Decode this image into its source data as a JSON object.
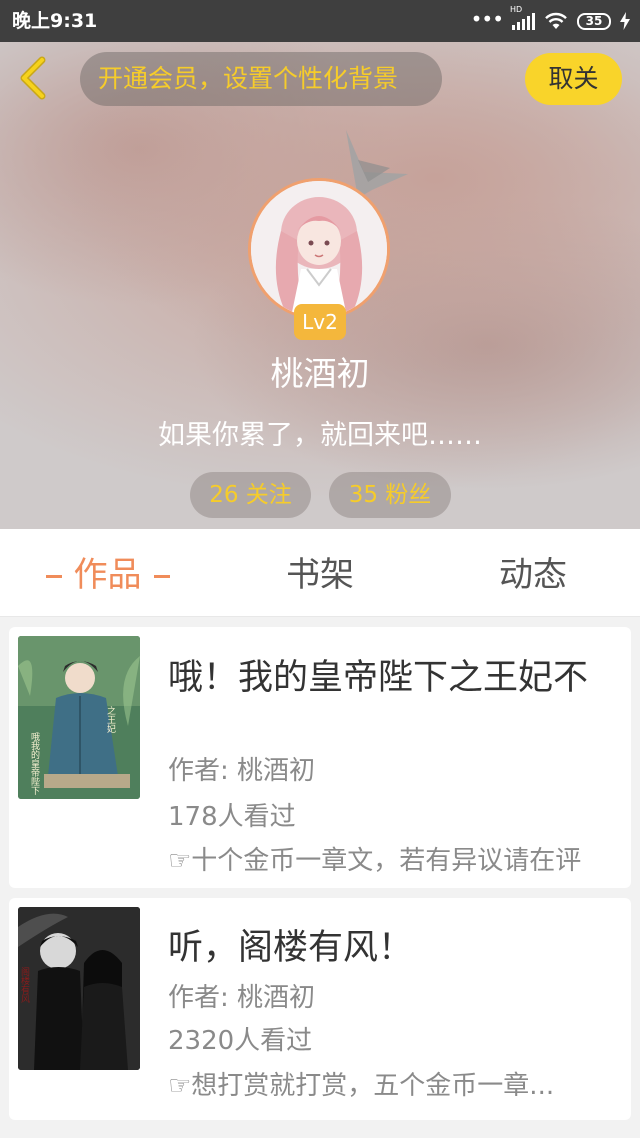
{
  "status_bar": {
    "time": "晚上9:31",
    "network_label": "HD",
    "battery": "35"
  },
  "header": {
    "vip_banner": "开通会员，设置个性化背景",
    "cancel_label": "取关",
    "level": "Lv2",
    "username": "桃酒初",
    "bio": "如果你累了，就回来吧……",
    "following": "26 关注",
    "fans": "35 粉丝"
  },
  "tabs": [
    {
      "label": "作品",
      "active": true
    },
    {
      "label": "书架",
      "active": false
    },
    {
      "label": "动态",
      "active": false
    }
  ],
  "works": [
    {
      "title": "哦！我的皇帝陛下之王妃不",
      "author": "作者: 桃酒初",
      "views": "178人看过",
      "note": "☞十个金币一章文，若有异议请在评"
    },
    {
      "title": "听，阁楼有风！",
      "author": "作者: 桃酒初",
      "views": "2320人看过",
      "note": "☞想打赏就打赏，五个金币一章..."
    }
  ],
  "colors": {
    "accent_yellow": "#f6cc2a",
    "button_yellow": "#f9d42a",
    "active_tab": "#f08c5a",
    "badge": "#f4b73c",
    "status_bar": "#3f3f3f"
  }
}
